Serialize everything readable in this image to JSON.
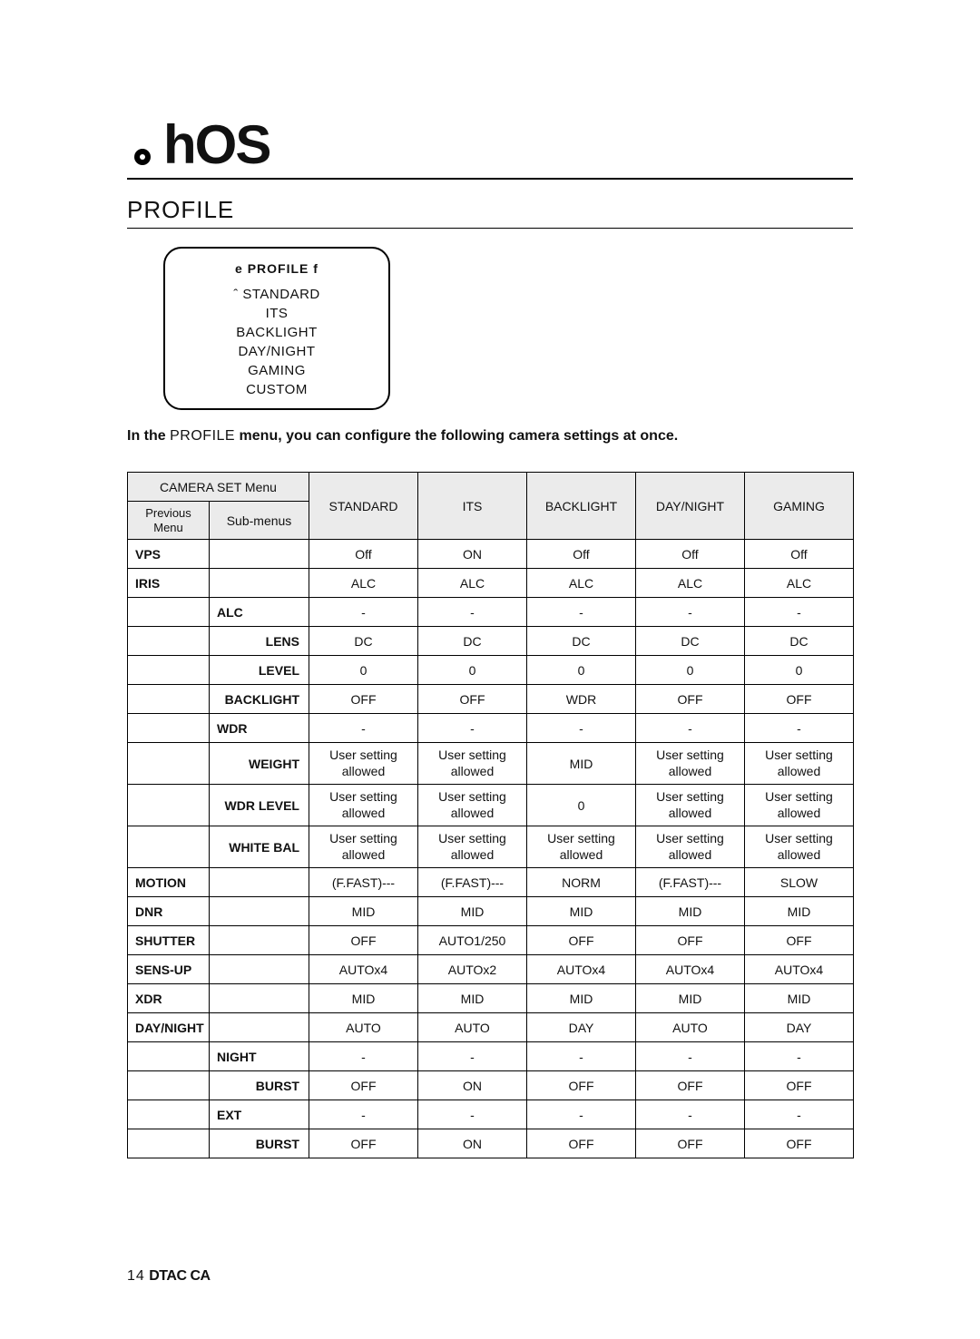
{
  "header": {
    "title": "hOS"
  },
  "section": {
    "title": "PROFILE"
  },
  "osd": {
    "title_left": "e",
    "title_mid": "PROFILE",
    "title_right": "f",
    "marker": "ˆ",
    "items": [
      "STANDARD",
      "ITS",
      "BACKLIGHT",
      "DAY/NIGHT",
      "GAMING",
      "CUSTOM"
    ]
  },
  "intro": {
    "prefix": "In the",
    "profile_word": "PROFILE",
    "suffix": " menu, you can conﬁgure the following camera settings at once."
  },
  "table": {
    "hdr_camera_set": "CAMERA SET Menu",
    "hdr_prev": "Previous",
    "hdr_prev2": "Menu",
    "hdr_sub": "Sub-menus",
    "cols": [
      "STANDARD",
      "ITS",
      "BACKLIGHT",
      "DAY/NIGHT",
      "GAMING"
    ],
    "rows": [
      {
        "prev": "VPS",
        "sub": "",
        "v": [
          "Off",
          "ON",
          "Off",
          "Off",
          "Off"
        ]
      },
      {
        "prev": "IRIS",
        "sub": "",
        "v": [
          "ALC",
          "ALC",
          "ALC",
          "ALC",
          "ALC"
        ]
      },
      {
        "prev": "",
        "sub": "ALC",
        "subAlign": "left",
        "v": [
          "-",
          "-",
          "-",
          "-",
          "-"
        ]
      },
      {
        "prev": "",
        "sub": "LENS",
        "v": [
          "DC",
          "DC",
          "DC",
          "DC",
          "DC"
        ]
      },
      {
        "prev": "",
        "sub": "LEVEL",
        "v": [
          "0",
          "0",
          "0",
          "0",
          "0"
        ]
      },
      {
        "prev": "",
        "sub": "BACKLIGHT",
        "v": [
          "OFF",
          "OFF",
          "WDR",
          "OFF",
          "OFF"
        ]
      },
      {
        "prev": "",
        "sub": "WDR",
        "subAlign": "left",
        "v": [
          "-",
          "-",
          "-",
          "-",
          "-"
        ]
      },
      {
        "prev": "",
        "sub": "WEIGHT",
        "wrap": true,
        "v": [
          "User setting allowed",
          "User setting allowed",
          "MID",
          "User setting allowed",
          "User setting allowed"
        ]
      },
      {
        "prev": "",
        "sub": "WDR LEVEL",
        "wrap": true,
        "v": [
          "User setting allowed",
          "User setting allowed",
          "0",
          "User setting allowed",
          "User setting allowed"
        ]
      },
      {
        "prev": "",
        "sub": "WHITE BAL",
        "wrap": true,
        "v": [
          "User setting allowed",
          "User setting allowed",
          "User setting allowed",
          "User setting allowed",
          "User setting allowed"
        ]
      },
      {
        "prev": "MOTION",
        "sub": "",
        "v": [
          "(F.FAST)---",
          "(F.FAST)---",
          "NORM",
          "(F.FAST)---",
          "SLOW"
        ]
      },
      {
        "prev": "DNR",
        "sub": "",
        "v": [
          "MID",
          "MID",
          "MID",
          "MID",
          "MID"
        ]
      },
      {
        "prev": "SHUTTER",
        "sub": "",
        "v": [
          "OFF",
          "AUTO1/250",
          "OFF",
          "OFF",
          "OFF"
        ]
      },
      {
        "prev": "SENS-UP",
        "sub": "",
        "v": [
          "AUTOx4",
          "AUTOx2",
          "AUTOx4",
          "AUTOx4",
          "AUTOx4"
        ]
      },
      {
        "prev": "XDR",
        "sub": "",
        "v": [
          "MID",
          "MID",
          "MID",
          "MID",
          "MID"
        ]
      },
      {
        "prev": "DAY/NIGHT",
        "sub": "",
        "v": [
          "AUTO",
          "AUTO",
          "DAY",
          "AUTO",
          "DAY"
        ]
      },
      {
        "prev": "",
        "sub": "NIGHT",
        "subAlign": "left",
        "v": [
          "-",
          "-",
          "-",
          "-",
          "-"
        ]
      },
      {
        "prev": "",
        "sub": "BURST",
        "v": [
          "OFF",
          "ON",
          "OFF",
          "OFF",
          "OFF"
        ]
      },
      {
        "prev": "",
        "sub": "EXT",
        "subAlign": "left",
        "v": [
          "-",
          "-",
          "-",
          "-",
          "-"
        ]
      },
      {
        "prev": "",
        "sub": "BURST",
        "v": [
          "OFF",
          "ON",
          "OFF",
          "OFF",
          "OFF"
        ]
      }
    ]
  },
  "footer": {
    "page": "14",
    "text": "DTAC CA"
  }
}
